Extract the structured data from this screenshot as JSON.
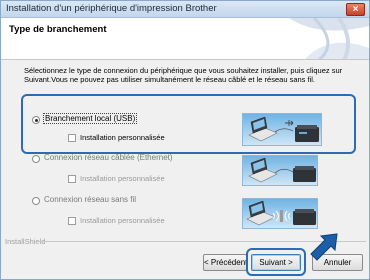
{
  "window": {
    "title": "Installation d'un périphérique d'impression Brother",
    "close_glyph": "×"
  },
  "page": {
    "title": "Type de branchement",
    "instructions": "Sélectionnez le type de connexion du périphérique que vous souhaitez installer, puis cliquez sur Suivant.Vous ne pouvez pas utiliser simultanément le réseau câblé et le réseau sans fil."
  },
  "options": [
    {
      "label": "Branchement local (USB)",
      "selected": true,
      "checkbox_label": "Installation personnalisée",
      "icon": "usb-connection-icon"
    },
    {
      "label": "Connexion réseau câblée (Ethernet)",
      "selected": false,
      "checkbox_label": "Installation personnalisée",
      "icon": "ethernet-connection-icon"
    },
    {
      "label": "Connexion réseau sans fil",
      "selected": false,
      "checkbox_label": "Installation personnalisée",
      "icon": "wireless-connection-icon"
    }
  ],
  "footer": {
    "brand": "InstallShield",
    "back_label": "< Précédent",
    "next_label": "Suivant >",
    "cancel_label": "Annuler"
  },
  "colors": {
    "accent": "#2d6bb3",
    "titlebar": "#c3d6ec",
    "close": "#c8402a"
  }
}
